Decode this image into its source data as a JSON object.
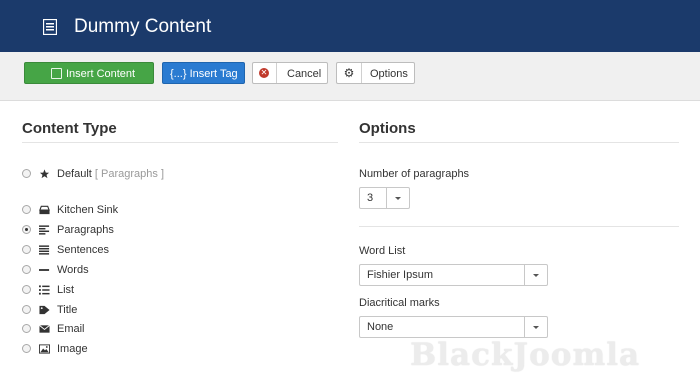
{
  "header": {
    "title": "Dummy Content",
    "icon": "list-icon"
  },
  "toolbar": {
    "insert_content_label": "Insert Content",
    "insert_tag_label": "{...} Insert Tag",
    "cancel_label": "Cancel",
    "options_label": "Options",
    "colors": {
      "insert": "#46a546",
      "tag": "#2a7bd1"
    }
  },
  "content_type": {
    "title": "Content Type",
    "default_option": {
      "label": "Default",
      "hint": "[ Paragraphs ]",
      "icon": "star-icon"
    },
    "options": [
      {
        "label": "Kitchen Sink",
        "icon": "sink-icon",
        "checked": false
      },
      {
        "label": "Paragraphs",
        "icon": "paragraph-icon",
        "checked": true
      },
      {
        "label": "Sentences",
        "icon": "sentences-icon",
        "checked": false
      },
      {
        "label": "Words",
        "icon": "minus-icon",
        "checked": false
      },
      {
        "label": "List",
        "icon": "list-icon",
        "checked": false
      },
      {
        "label": "Title",
        "icon": "tag-icon",
        "checked": false
      },
      {
        "label": "Email",
        "icon": "envelope-icon",
        "checked": false
      },
      {
        "label": "Image",
        "icon": "image-icon",
        "checked": false
      }
    ]
  },
  "options": {
    "title": "Options",
    "paragraphs_label": "Number of paragraphs",
    "paragraphs_value": "3",
    "word_list_label": "Word List",
    "word_list_value": "Fishier Ipsum",
    "diacritical_label": "Diacritical marks",
    "diacritical_value": "None"
  },
  "watermark": "BlackJoomla"
}
